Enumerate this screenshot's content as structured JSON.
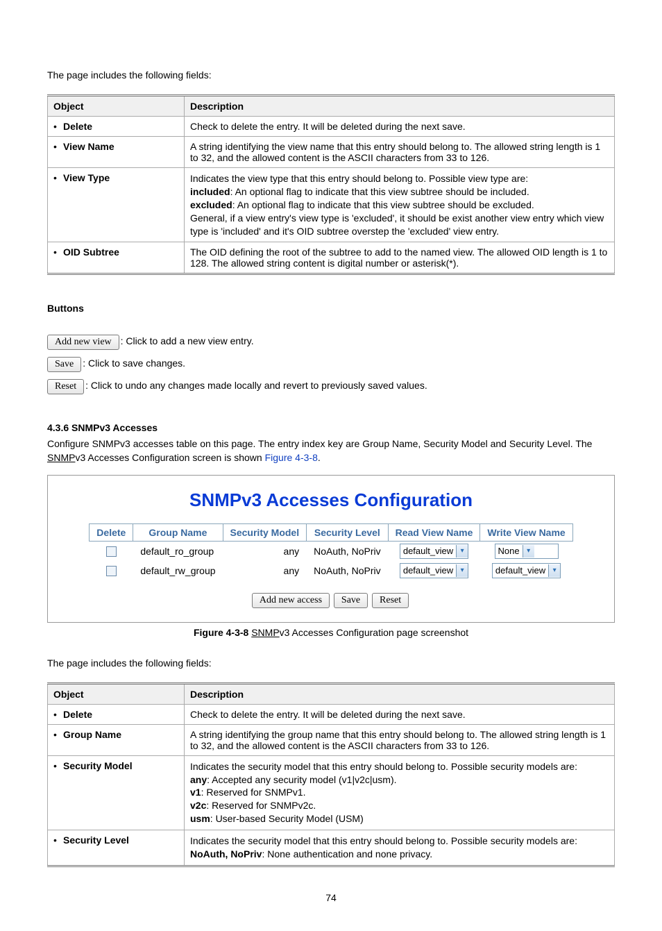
{
  "intro1": "The page includes the following fields:",
  "table1": {
    "h_obj": "Object",
    "h_desc": "Description",
    "rows": [
      {
        "obj": "Delete",
        "desc": "Check to delete the entry. It will be deleted during the next save."
      },
      {
        "obj": "View Name",
        "desc": "A string identifying the view name that this entry should belong to. The allowed string length is 1 to 32, and the allowed content is the ASCII characters from 33 to 126."
      },
      {
        "obj": "View Type",
        "desc": "Indicates the view type that this entry should belong to. Possible view type are:",
        "subs": [
          {
            "b": "included",
            "t": ": An optional flag to indicate that this view subtree should be included."
          },
          {
            "b": "excluded",
            "t": ": An optional flag to indicate that this view subtree should be excluded."
          }
        ],
        "tail": "General, if a view entry's view type is 'excluded', it should be exist another view entry which view type is 'included' and it's OID subtree overstep the 'excluded' view entry."
      },
      {
        "obj": "OID Subtree",
        "desc": "The OID defining the root of the subtree to add to the named view. The allowed OID length is 1 to 128. The allowed string content is digital number or asterisk(*)."
      }
    ]
  },
  "buttons_heading": "Buttons",
  "btn_rows": [
    {
      "btn": "Add new view",
      "desc": ": Click to add a new view entry."
    },
    {
      "btn": "Save",
      "desc": ": Click to save changes."
    },
    {
      "btn": "Reset",
      "desc": ": Click to undo any changes made locally and revert to previously saved values."
    }
  ],
  "section2": {
    "heading": "4.3.6 SNMPv3 Accesses",
    "body_pre": "Configure SNMPv3 accesses table on this page. The entry index key are Group Name, Security Model and Security Level. The ",
    "snmp": "SNMP",
    "body_mid": "v3 Accesses Configuration screen is shown ",
    "fig": "Figure 4-3-8",
    "body_post": "."
  },
  "screenshot": {
    "title": "SNMPv3 Accesses Configuration",
    "headers": [
      "Delete",
      "Group Name",
      "Security Model",
      "Security Level",
      "Read View Name",
      "Write View Name"
    ],
    "rows": [
      {
        "group": "default_ro_group",
        "model": "any",
        "level": "NoAuth, NoPriv",
        "read": "default_view",
        "write": "None"
      },
      {
        "group": "default_rw_group",
        "model": "any",
        "level": "NoAuth, NoPriv",
        "read": "default_view",
        "write": "default_view"
      }
    ],
    "buttons": [
      "Add new access",
      "Save",
      "Reset"
    ]
  },
  "caption": {
    "fig": "Figure 4-3-8 ",
    "snmp": "SNMP",
    "rest": "v3 Accesses Configuration page screenshot"
  },
  "intro2": "The page includes the following fields:",
  "table2": {
    "h_obj": "Object",
    "h_desc": "Description",
    "rows": [
      {
        "obj": "Delete",
        "desc": "Check to delete the entry. It will be deleted during the next save."
      },
      {
        "obj": "Group Name",
        "desc": "A string identifying the group name that this entry should belong to. The allowed string length is 1 to 32, and the allowed content is the ASCII characters from 33 to 126."
      },
      {
        "obj": "Security Model",
        "desc": "Indicates the security model that this entry should belong to. Possible security models are:",
        "subs": [
          {
            "b": "any",
            "t": ": Accepted any security model (v1|v2c|usm)."
          },
          {
            "b": "v1",
            "t": ": Reserved for SNMPv1."
          },
          {
            "b": "v2c",
            "t": ": Reserved for SNMPv2c."
          },
          {
            "b": "usm",
            "t": ": User-based Security Model (USM)"
          }
        ]
      },
      {
        "obj": "Security Level",
        "desc": "Indicates the security model that this entry should belong to. Possible security models are:",
        "subs": [
          {
            "b": "NoAuth, NoPriv",
            "t": ": None authentication and none privacy."
          }
        ]
      }
    ]
  },
  "page_num": "74"
}
